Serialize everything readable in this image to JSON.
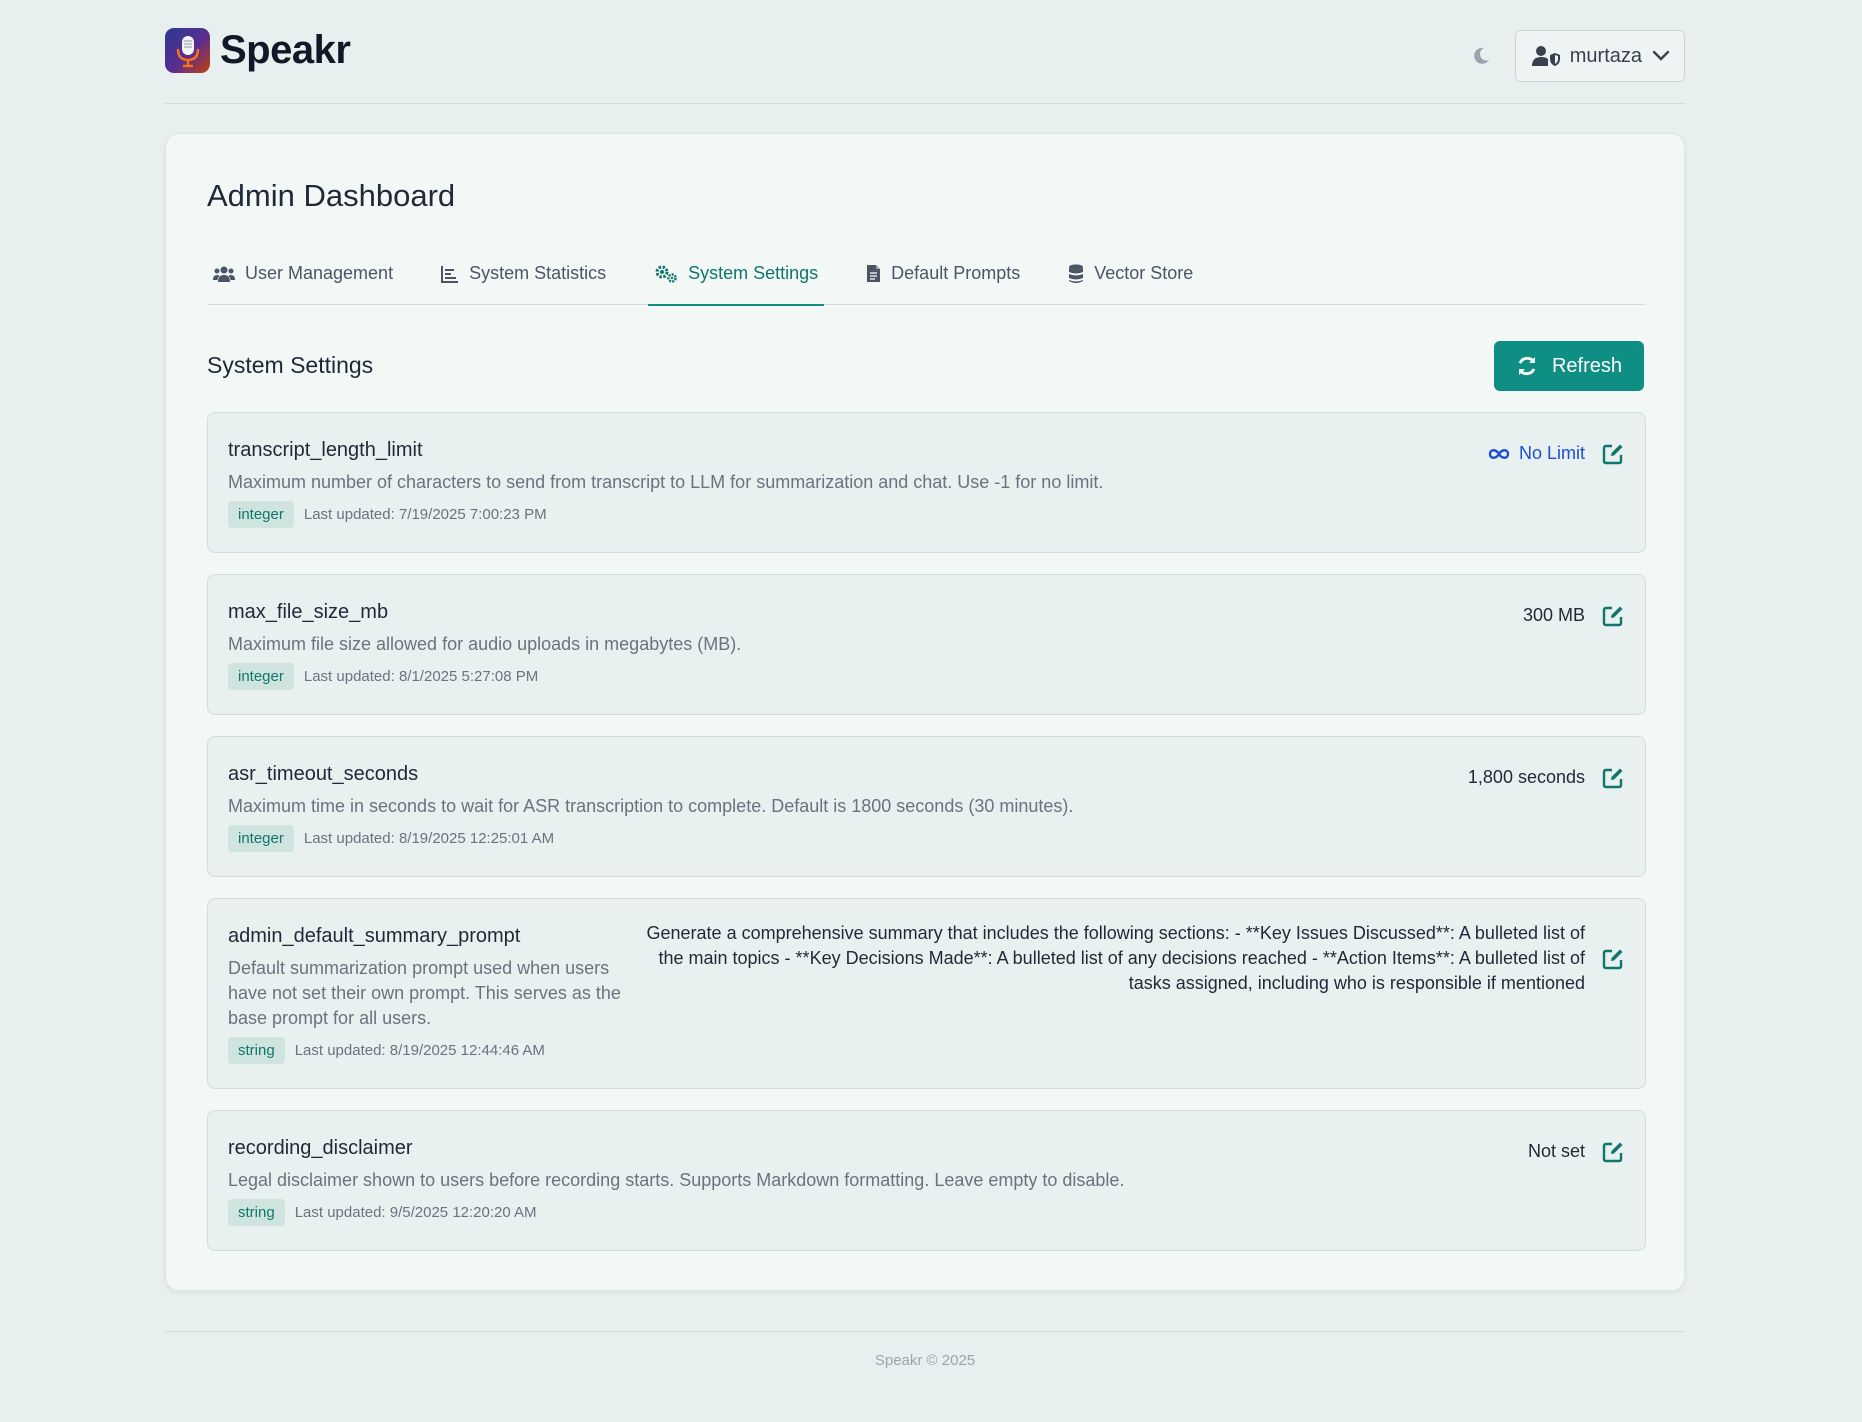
{
  "app": {
    "name": "Speakr"
  },
  "header": {
    "user_name": "murtaza"
  },
  "dashboard": {
    "title": "Admin Dashboard",
    "tabs": [
      {
        "label": "User Management"
      },
      {
        "label": "System Statistics"
      },
      {
        "label": "System Settings"
      },
      {
        "label": "Default Prompts"
      },
      {
        "label": "Vector Store"
      }
    ],
    "active_tab": "System Settings"
  },
  "settings_section": {
    "title": "System Settings",
    "refresh_label": "Refresh",
    "items": [
      {
        "key": "transcript_length_limit",
        "description": "Maximum number of characters to send from transcript to LLM for summarization and chat. Use -1 for no limit.",
        "type": "integer",
        "updated": "Last updated: 7/19/2025 7:00:23 PM",
        "value": "No Limit"
      },
      {
        "key": "max_file_size_mb",
        "description": "Maximum file size allowed for audio uploads in megabytes (MB).",
        "type": "integer",
        "updated": "Last updated: 8/1/2025 5:27:08 PM",
        "value": "300 MB"
      },
      {
        "key": "asr_timeout_seconds",
        "description": "Maximum time in seconds to wait for ASR transcription to complete. Default is 1800 seconds (30 minutes).",
        "type": "integer",
        "updated": "Last updated: 8/19/2025 12:25:01 AM",
        "value": "1,800 seconds"
      },
      {
        "key": "admin_default_summary_prompt",
        "description": "Default summarization prompt used when users have not set their own prompt. This serves as the base prompt for all users.",
        "type": "string",
        "updated": "Last updated: 8/19/2025 12:44:46 AM",
        "value": "Generate a comprehensive summary that includes the following sections: - **Key Issues Discussed**: A bulleted list of the main topics - **Key Decisions Made**: A bulleted list of any decisions reached - **Action Items**: A bulleted list of tasks assigned, including who is responsible if mentioned"
      },
      {
        "key": "recording_disclaimer",
        "description": "Legal disclaimer shown to users before recording starts. Supports Markdown formatting. Leave empty to disable.",
        "type": "string",
        "updated": "Last updated: 9/5/2025 12:20:20 AM",
        "value": "Not set"
      }
    ]
  },
  "footer": {
    "text": "Speakr © 2025"
  },
  "colors": {
    "accent": "#0f8f83",
    "link": "#1d4ed8",
    "background": "#e8f0ef"
  }
}
